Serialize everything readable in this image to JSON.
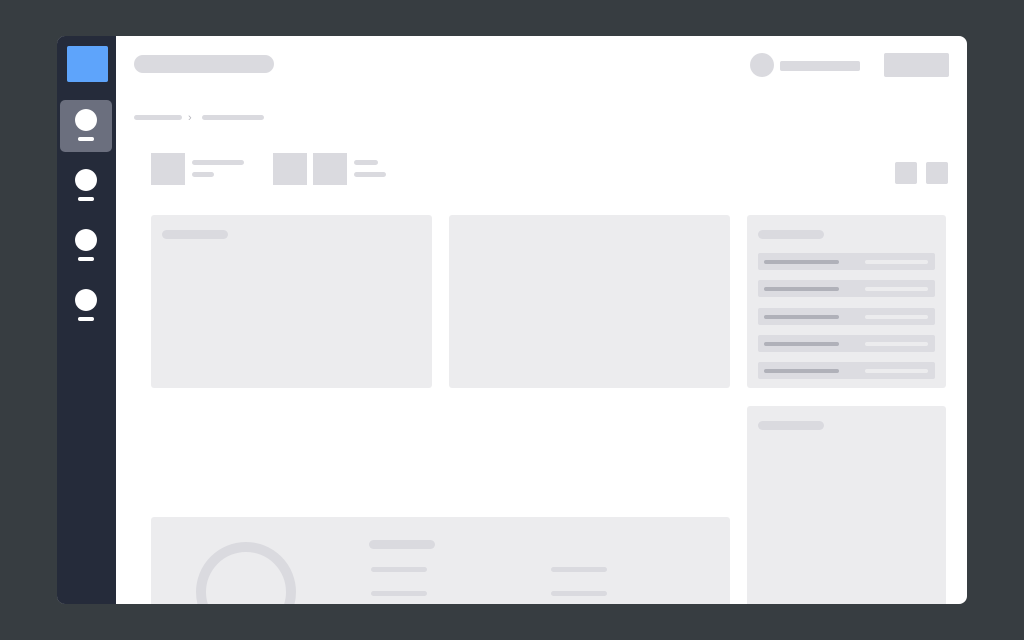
{
  "breadcrumb": {
    "separator": "›"
  },
  "sidebar": {
    "items": [
      {
        "id": "nav-1",
        "active": true
      },
      {
        "id": "nav-2",
        "active": false
      },
      {
        "id": "nav-3",
        "active": false
      },
      {
        "id": "nav-4",
        "active": false
      }
    ]
  },
  "sidepanel": {
    "rows": 5
  },
  "colors": {
    "backdrop": "#373d41",
    "sidebar": "#252b3a",
    "accent": "#5ea4fb",
    "placeholder": "#dadadf",
    "panel": "#ececee"
  }
}
